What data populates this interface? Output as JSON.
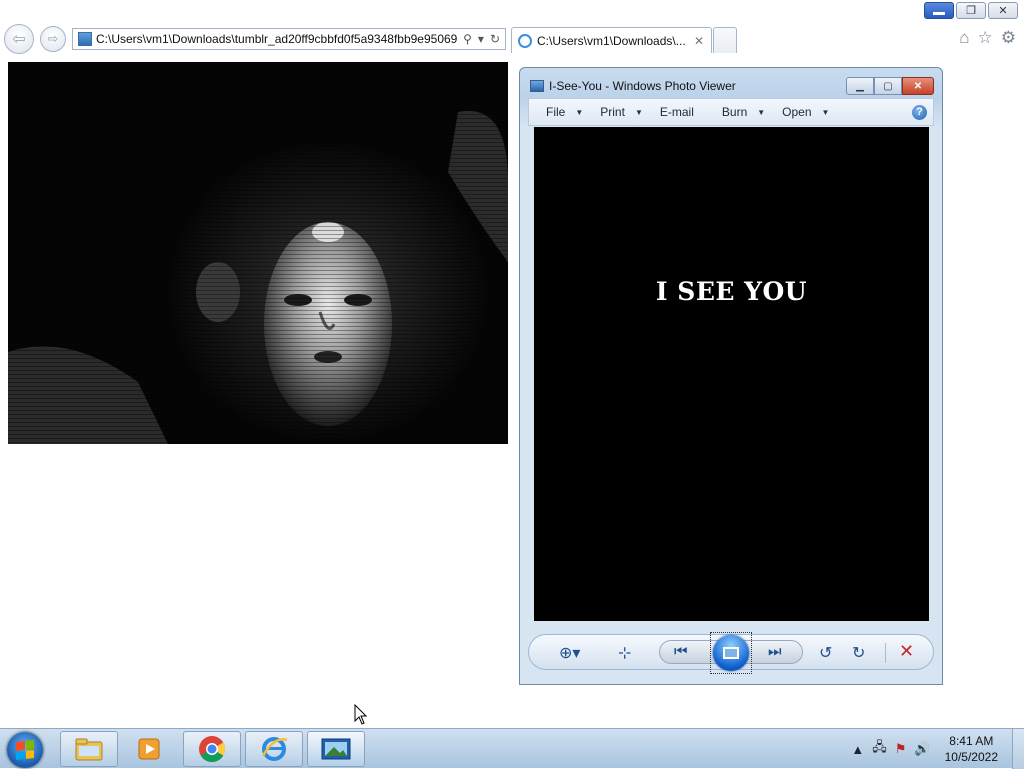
{
  "browser": {
    "address_url": "C:\\Users\\vm1\\Downloads\\tumblr_ad20ff9cbbfd0f5a9348fbb9e95069",
    "tabs": [
      {
        "label": "C:\\Users\\vm1\\Downloads\\...",
        "active": true
      }
    ]
  },
  "page": {
    "image_icon": "doll-face-photo"
  },
  "photo_viewer": {
    "title": "I-See-You - Windows Photo Viewer",
    "menu": [
      {
        "label": "File",
        "has_dropdown": true
      },
      {
        "label": "Print",
        "has_dropdown": true
      },
      {
        "label": "E-mail",
        "has_dropdown": false
      },
      {
        "label": "Burn",
        "has_dropdown": true
      },
      {
        "label": "Open",
        "has_dropdown": true
      }
    ],
    "image_text": "I SEE YOU",
    "accent": "#1f5fae"
  },
  "taskbar": {
    "apps": [
      "file-explorer-icon",
      "media-player-icon",
      "chrome-icon",
      "internet-explorer-icon",
      "photo-viewer-icon"
    ],
    "clock_time": "8:41 AM",
    "clock_date": "10/5/2022"
  }
}
